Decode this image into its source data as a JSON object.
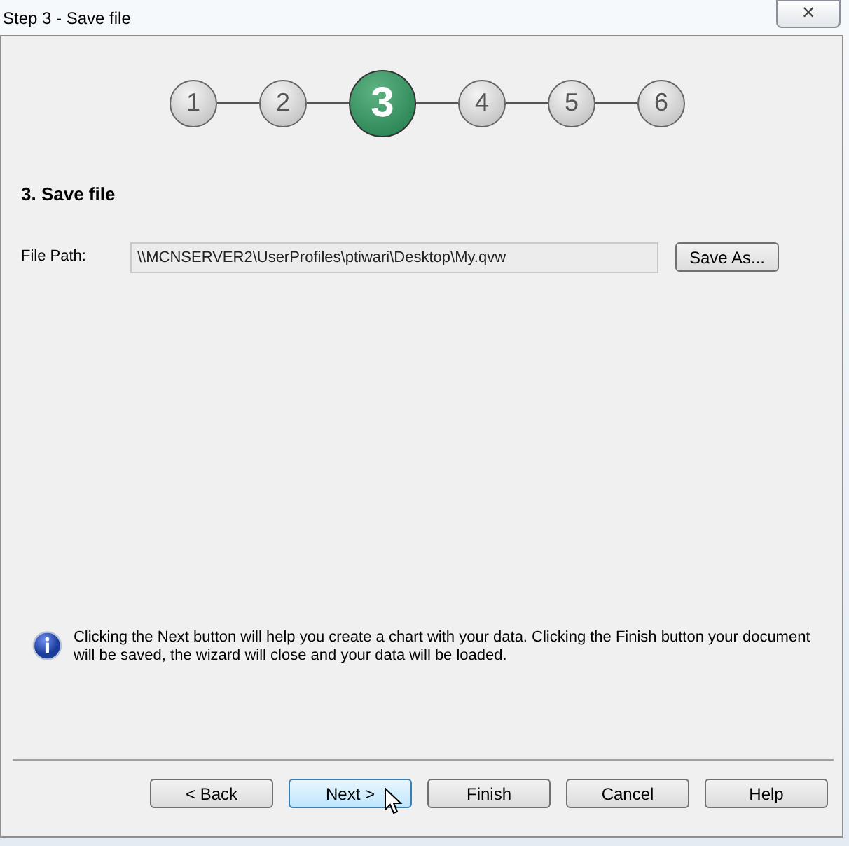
{
  "window": {
    "title": "Step 3 - Save file",
    "close": "×"
  },
  "steps": [
    {
      "label": "1",
      "selected": false
    },
    {
      "label": "2",
      "selected": false
    },
    {
      "label": "3",
      "selected": true
    },
    {
      "label": "4",
      "selected": false
    },
    {
      "label": "5",
      "selected": false
    },
    {
      "label": "6",
      "selected": false
    }
  ],
  "heading": "3. Save file",
  "file_path": {
    "label": "File Path:",
    "value": "\\\\MCNSERVER2\\UserProfiles\\ptiwari\\Desktop\\My.qvw",
    "button": "Save As..."
  },
  "info": "Clicking the Next button will help you create a chart with your data. Clicking the Finish button your document will be saved, the wizard will close and your data will be loaded.",
  "buttons": [
    {
      "label": "< Back",
      "hovered": false
    },
    {
      "label": "Next >",
      "hovered": true
    },
    {
      "label": "Finish",
      "hovered": false
    },
    {
      "label": "Cancel",
      "hovered": false
    },
    {
      "label": "Help",
      "hovered": false
    }
  ]
}
